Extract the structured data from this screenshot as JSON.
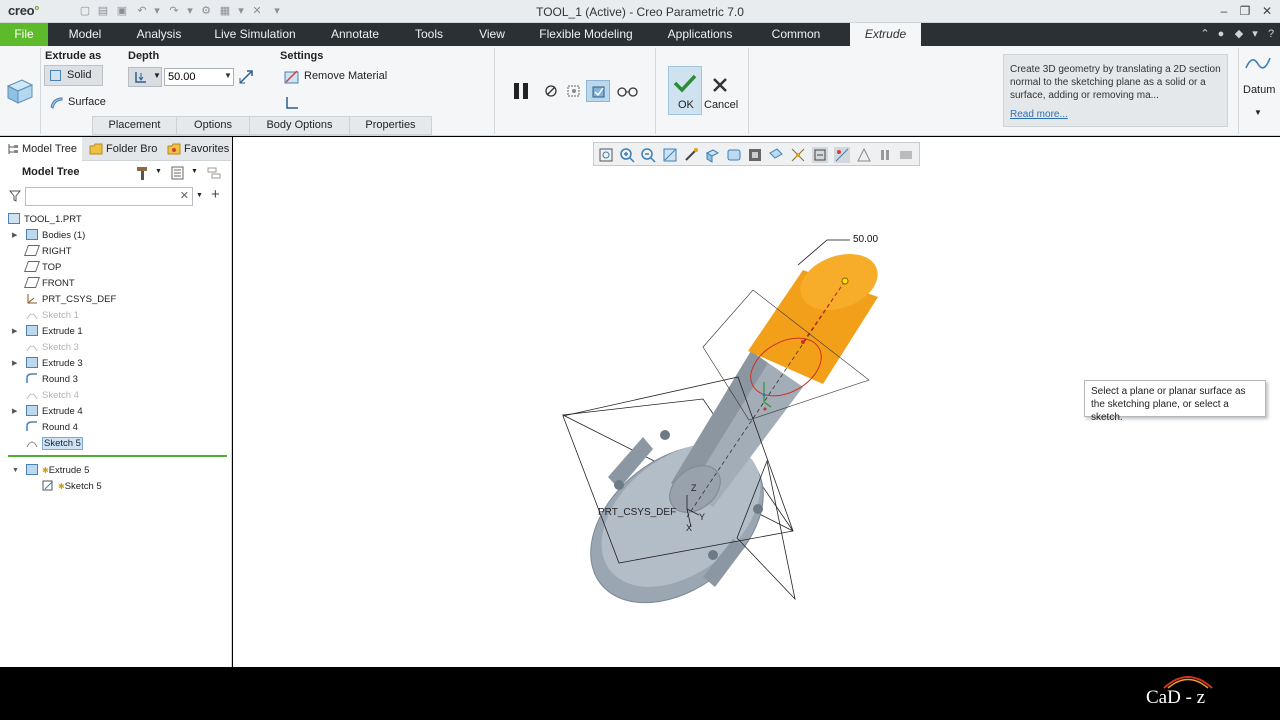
{
  "app": {
    "logo": "creo",
    "window_title": "TOOL_1 (Active) - Creo Parametric 7.0"
  },
  "menubar": {
    "items": [
      "File",
      "Model",
      "Analysis",
      "Live Simulation",
      "Annotate",
      "Tools",
      "View",
      "Flexible Modeling",
      "Applications",
      "Common",
      "Extrude"
    ],
    "active": "Extrude"
  },
  "ribbon": {
    "extrude_as_label": "Extrude as",
    "solid_label": "Solid",
    "surface_label": "Surface",
    "depth_label": "Depth",
    "depth_value": "50.00",
    "settings_label": "Settings",
    "remove_material_label": "Remove Material",
    "tabs": [
      "Placement",
      "Options",
      "Body Options",
      "Properties"
    ],
    "ok_label": "OK",
    "cancel_label": "Cancel",
    "help_text": "Create 3D geometry by translating a 2D section normal to the sketching plane as a solid or a surface, adding or removing ma...",
    "read_more": "Read more...",
    "datum_label": "Datum"
  },
  "panel": {
    "tabs": [
      "Model Tree",
      "Folder Bro",
      "Favorites"
    ],
    "header": "Model Tree",
    "filter_placeholder": "",
    "tree": [
      {
        "label": "TOOL_1.PRT",
        "dim": false,
        "expander": false
      },
      {
        "label": "Bodies (1)",
        "dim": false,
        "expander": true
      },
      {
        "label": "RIGHT",
        "dim": false,
        "expander": false
      },
      {
        "label": "TOP",
        "dim": false,
        "expander": false
      },
      {
        "label": "FRONT",
        "dim": false,
        "expander": false
      },
      {
        "label": "PRT_CSYS_DEF",
        "dim": false,
        "expander": false
      },
      {
        "label": "Sketch 1",
        "dim": true,
        "expander": false
      },
      {
        "label": "Extrude 1",
        "dim": false,
        "expander": true
      },
      {
        "label": "Sketch 3",
        "dim": true,
        "expander": false
      },
      {
        "label": "Extrude 3",
        "dim": false,
        "expander": true
      },
      {
        "label": "Round 3",
        "dim": false,
        "expander": false
      },
      {
        "label": "Sketch 4",
        "dim": true,
        "expander": false
      },
      {
        "label": "Extrude 4",
        "dim": false,
        "expander": true
      },
      {
        "label": "Round 4",
        "dim": false,
        "expander": false
      },
      {
        "label": "Sketch 5",
        "dim": false,
        "expander": false
      }
    ],
    "current_feature": "Extrude 5",
    "current_child": "Sketch 5"
  },
  "viewport": {
    "dimension_label": "50.00",
    "csys_label": "PRT_CSYS_DEF",
    "axis_labels": [
      "Z",
      "Y",
      "X"
    ],
    "tooltip": "Select a plane or planar surface as the sketching plane, or select a sketch."
  },
  "watermark": "CaD - z"
}
